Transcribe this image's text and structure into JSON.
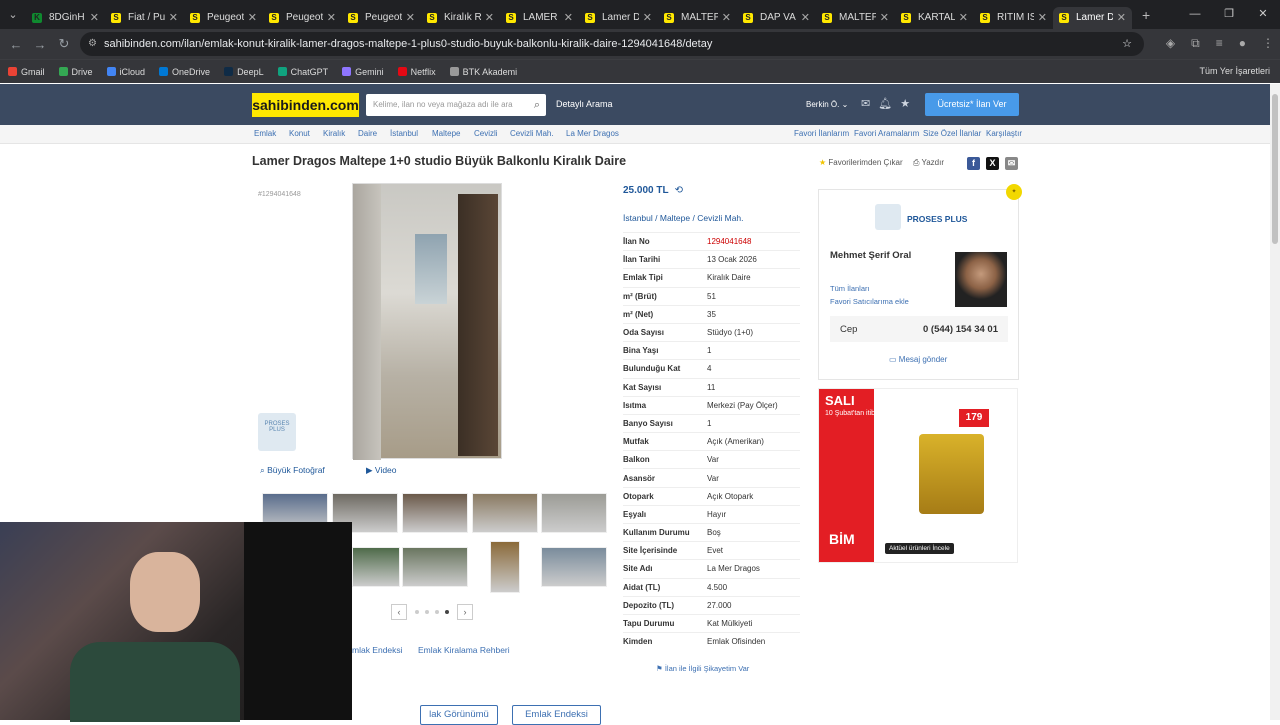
{
  "browser": {
    "tabs": [
      {
        "label": "8DGinH",
        "color": "#0f8a2f",
        "glyph": "K",
        "active": false
      },
      {
        "label": "Fiat / Pu",
        "color": "#ffe800",
        "glyph": "S",
        "active": false
      },
      {
        "label": "Peugeot",
        "color": "#ffe800",
        "glyph": "S",
        "active": false
      },
      {
        "label": "Peugeot",
        "color": "#ffe800",
        "glyph": "S",
        "active": false
      },
      {
        "label": "Peugeot",
        "color": "#ffe800",
        "glyph": "S",
        "active": false
      },
      {
        "label": "Kiralık R",
        "color": "#ffe800",
        "glyph": "S",
        "active": false
      },
      {
        "label": "LAMER D",
        "color": "#ffe800",
        "glyph": "S",
        "active": false
      },
      {
        "label": "Lamer D",
        "color": "#ffe800",
        "glyph": "S",
        "active": false
      },
      {
        "label": "MALTEPE",
        "color": "#ffe800",
        "glyph": "S",
        "active": false
      },
      {
        "label": "DAP VA",
        "color": "#ffe800",
        "glyph": "S",
        "active": false
      },
      {
        "label": "MALTEPE",
        "color": "#ffe800",
        "glyph": "S",
        "active": false
      },
      {
        "label": "KARTAL",
        "color": "#ffe800",
        "glyph": "S",
        "active": false
      },
      {
        "label": "RİTİM İS",
        "color": "#ffe800",
        "glyph": "S",
        "active": false
      },
      {
        "label": "Lamer D",
        "color": "#ffe800",
        "glyph": "S",
        "active": true
      }
    ],
    "url": "sahibinden.com/ilan/emlak-konut-kiralik-lamer-dragos-maltepe-1-plus0-studio-buyuk-balkonlu-kiralik-daire-1294041648/detay",
    "bookmarks": [
      "Gmail",
      "Drive",
      "iCloud",
      "OneDrive",
      "DeepL",
      "ChatGPT",
      "Gemini",
      "Netflix",
      "BTK Akademi"
    ],
    "all_bookmarks": "Tüm Yer İşaretleri"
  },
  "header": {
    "logo": "sahibinden.com",
    "search_placeholder": "Kelime, ilan no veya mağaza adı ile ara",
    "detailed_search": "Detaylı Arama",
    "user": "Berkin Ö.",
    "free_ad": "Ücretsiz* İlan Ver"
  },
  "breadcrumb": [
    "Emlak",
    "Konut",
    "Kiralık",
    "Daire",
    "İstanbul",
    "Maltepe",
    "Cevizli",
    "Cevizli Mah.",
    "La Mer Dragos"
  ],
  "top_links": [
    "Favori İlanlarım",
    "Favori Aramalarım",
    "Size Özel İlanlar",
    "Karşılaştır"
  ],
  "listing": {
    "title": "Lamer Dragos Maltepe 1+0 studio Büyük Balkonlu Kiralık Daire",
    "remove_fav": "Favorilerimden Çıkar",
    "print": "Yazdır",
    "ad_id": "#1294041648",
    "big_photo": "Büyük Fotoğraf",
    "video": "Video",
    "price": "25.000 TL",
    "location": [
      "İstanbul",
      "Maltepe",
      "Cevizli Mah."
    ],
    "details": [
      {
        "k": "İlan No",
        "v": "1294041648",
        "red": true
      },
      {
        "k": "İlan Tarihi",
        "v": "13 Ocak 2026"
      },
      {
        "k": "Emlak Tipi",
        "v": "Kiralık Daire"
      },
      {
        "k": "m² (Brüt)",
        "v": "51"
      },
      {
        "k": "m² (Net)",
        "v": "35"
      },
      {
        "k": "Oda Sayısı",
        "v": "Stüdyo (1+0)"
      },
      {
        "k": "Bina Yaşı",
        "v": "1"
      },
      {
        "k": "Bulunduğu Kat",
        "v": "4"
      },
      {
        "k": "Kat Sayısı",
        "v": "11"
      },
      {
        "k": "Isıtma",
        "v": "Merkezi (Pay Ölçer)"
      },
      {
        "k": "Banyo Sayısı",
        "v": "1"
      },
      {
        "k": "Mutfak",
        "v": "Açık (Amerikan)"
      },
      {
        "k": "Balkon",
        "v": "Var"
      },
      {
        "k": "Asansör",
        "v": "Var"
      },
      {
        "k": "Otopark",
        "v": "Açık Otopark"
      },
      {
        "k": "Eşyalı",
        "v": "Hayır"
      },
      {
        "k": "Kullanım Durumu",
        "v": "Boş"
      },
      {
        "k": "Site İçerisinde",
        "v": "Evet"
      },
      {
        "k": "Site Adı",
        "v": "La Mer Dragos"
      },
      {
        "k": "Aidat (TL)",
        "v": "4.500"
      },
      {
        "k": "Depozito (TL)",
        "v": "27.000"
      },
      {
        "k": "Tapu Durumu",
        "v": "Kat Mülkiyeti"
      },
      {
        "k": "Kimden",
        "v": "Emlak Ofisinden"
      }
    ],
    "complain": "İlan ile İlgili Şikayetim Var",
    "link_index": "mlak Endeksi",
    "link_guide": "Emlak Kiralama Rehberi",
    "btn_view": "lak Görünümü",
    "btn_index": "Emlak Endeksi"
  },
  "seller": {
    "company": "PROSES PLUS",
    "name": "Mehmet Şerif Oral",
    "all_ads": "Tüm İlanları",
    "fav_sellers": "Favori Satıcılarıma ekle",
    "phone_label": "Cep",
    "phone": "0 (544) 154 34 01",
    "message": "Mesaj gönder"
  },
  "ad": {
    "day": "SALI",
    "date": "10 Şubat'tan itibaren",
    "price": "179",
    "brand": "BİM",
    "cta": "Aktüel ürünleri İncele"
  }
}
